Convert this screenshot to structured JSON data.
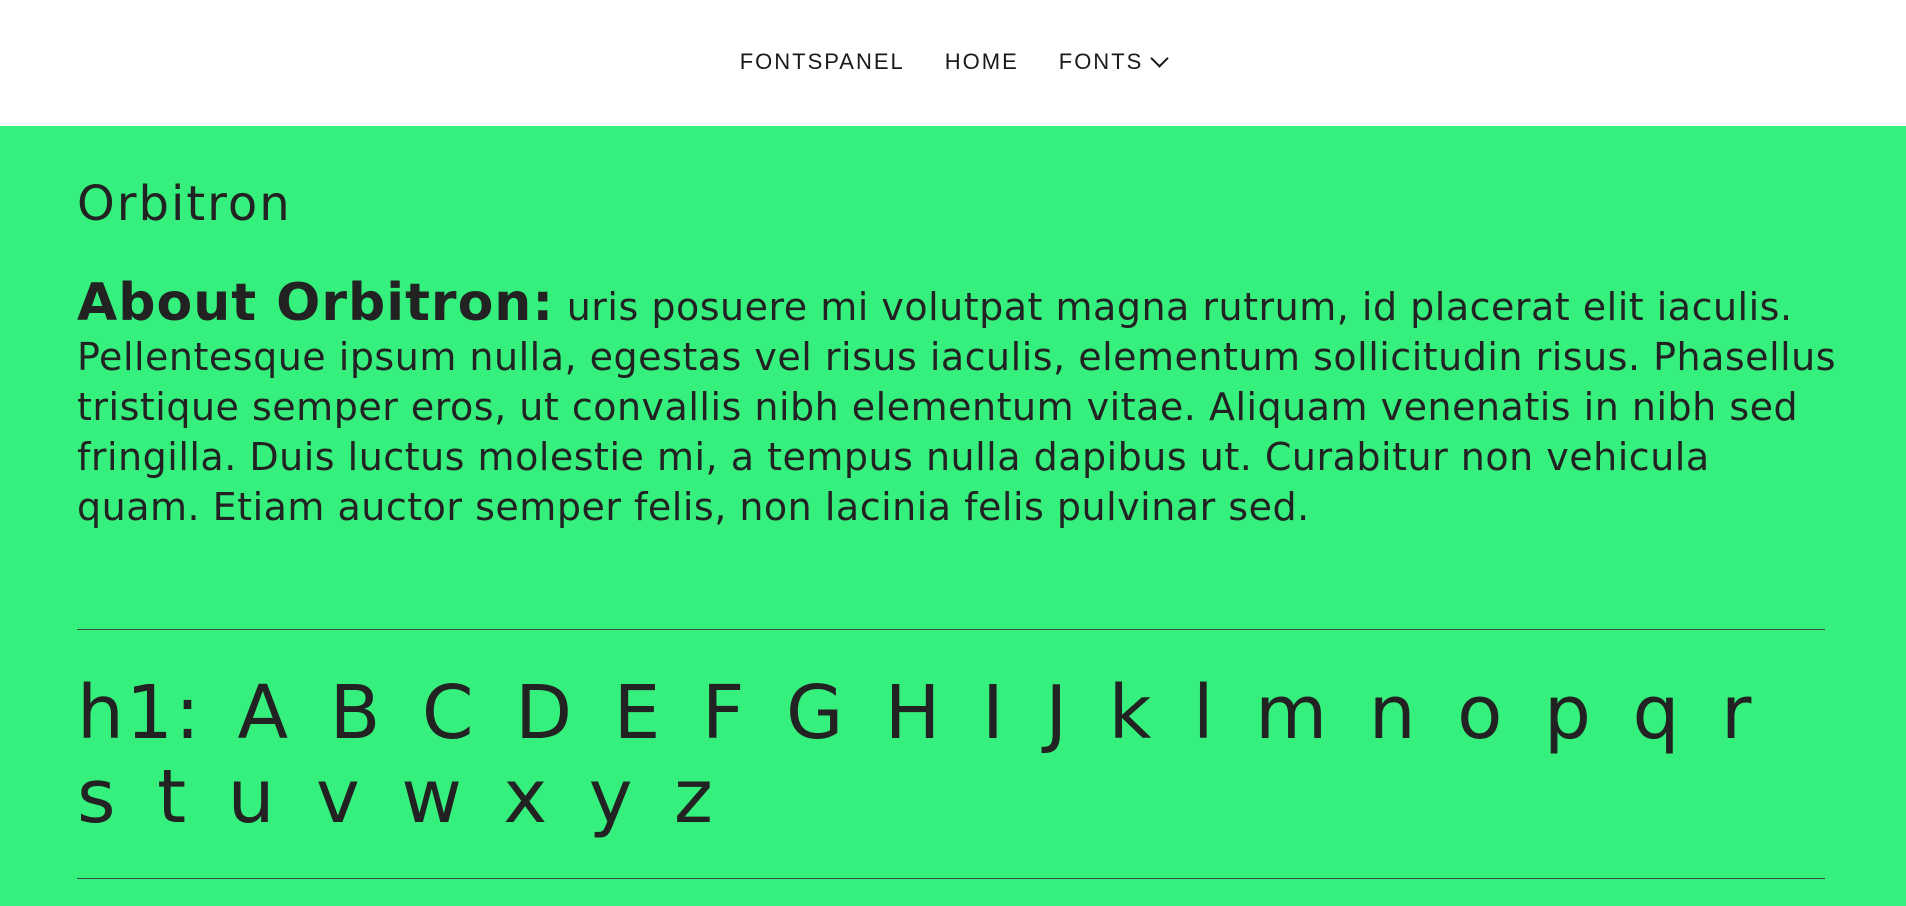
{
  "nav": {
    "brand": "FONTSPANEL",
    "home": "HOME",
    "fonts": "FONTS",
    "fonts_icon": "chevron-down-icon"
  },
  "page": {
    "title": "Orbitron",
    "about_label": "About Orbitron:",
    "about_text": " uris posuere mi volutpat magna rutrum, id placerat elit iaculis. Pellentesque ipsum nulla, egestas vel risus iaculis, elementum sollicitudin risus. Phasellus tristique semper eros, ut convallis nibh elementum vitae. Aliquam venenatis in nibh sed fringilla. Duis luctus molestie mi, a tempus nulla dapibus ut. Curabitur non vehicula quam. Etiam auctor semper felis, non lacinia felis pulvinar sed.",
    "h1_label": "h1:",
    "h1_sample": " A B C D E F G H I J k l m n o p q r s t u v w x y z"
  },
  "colors": {
    "background": "#36f07e",
    "text": "#222222",
    "nav_background": "#ffffff"
  }
}
